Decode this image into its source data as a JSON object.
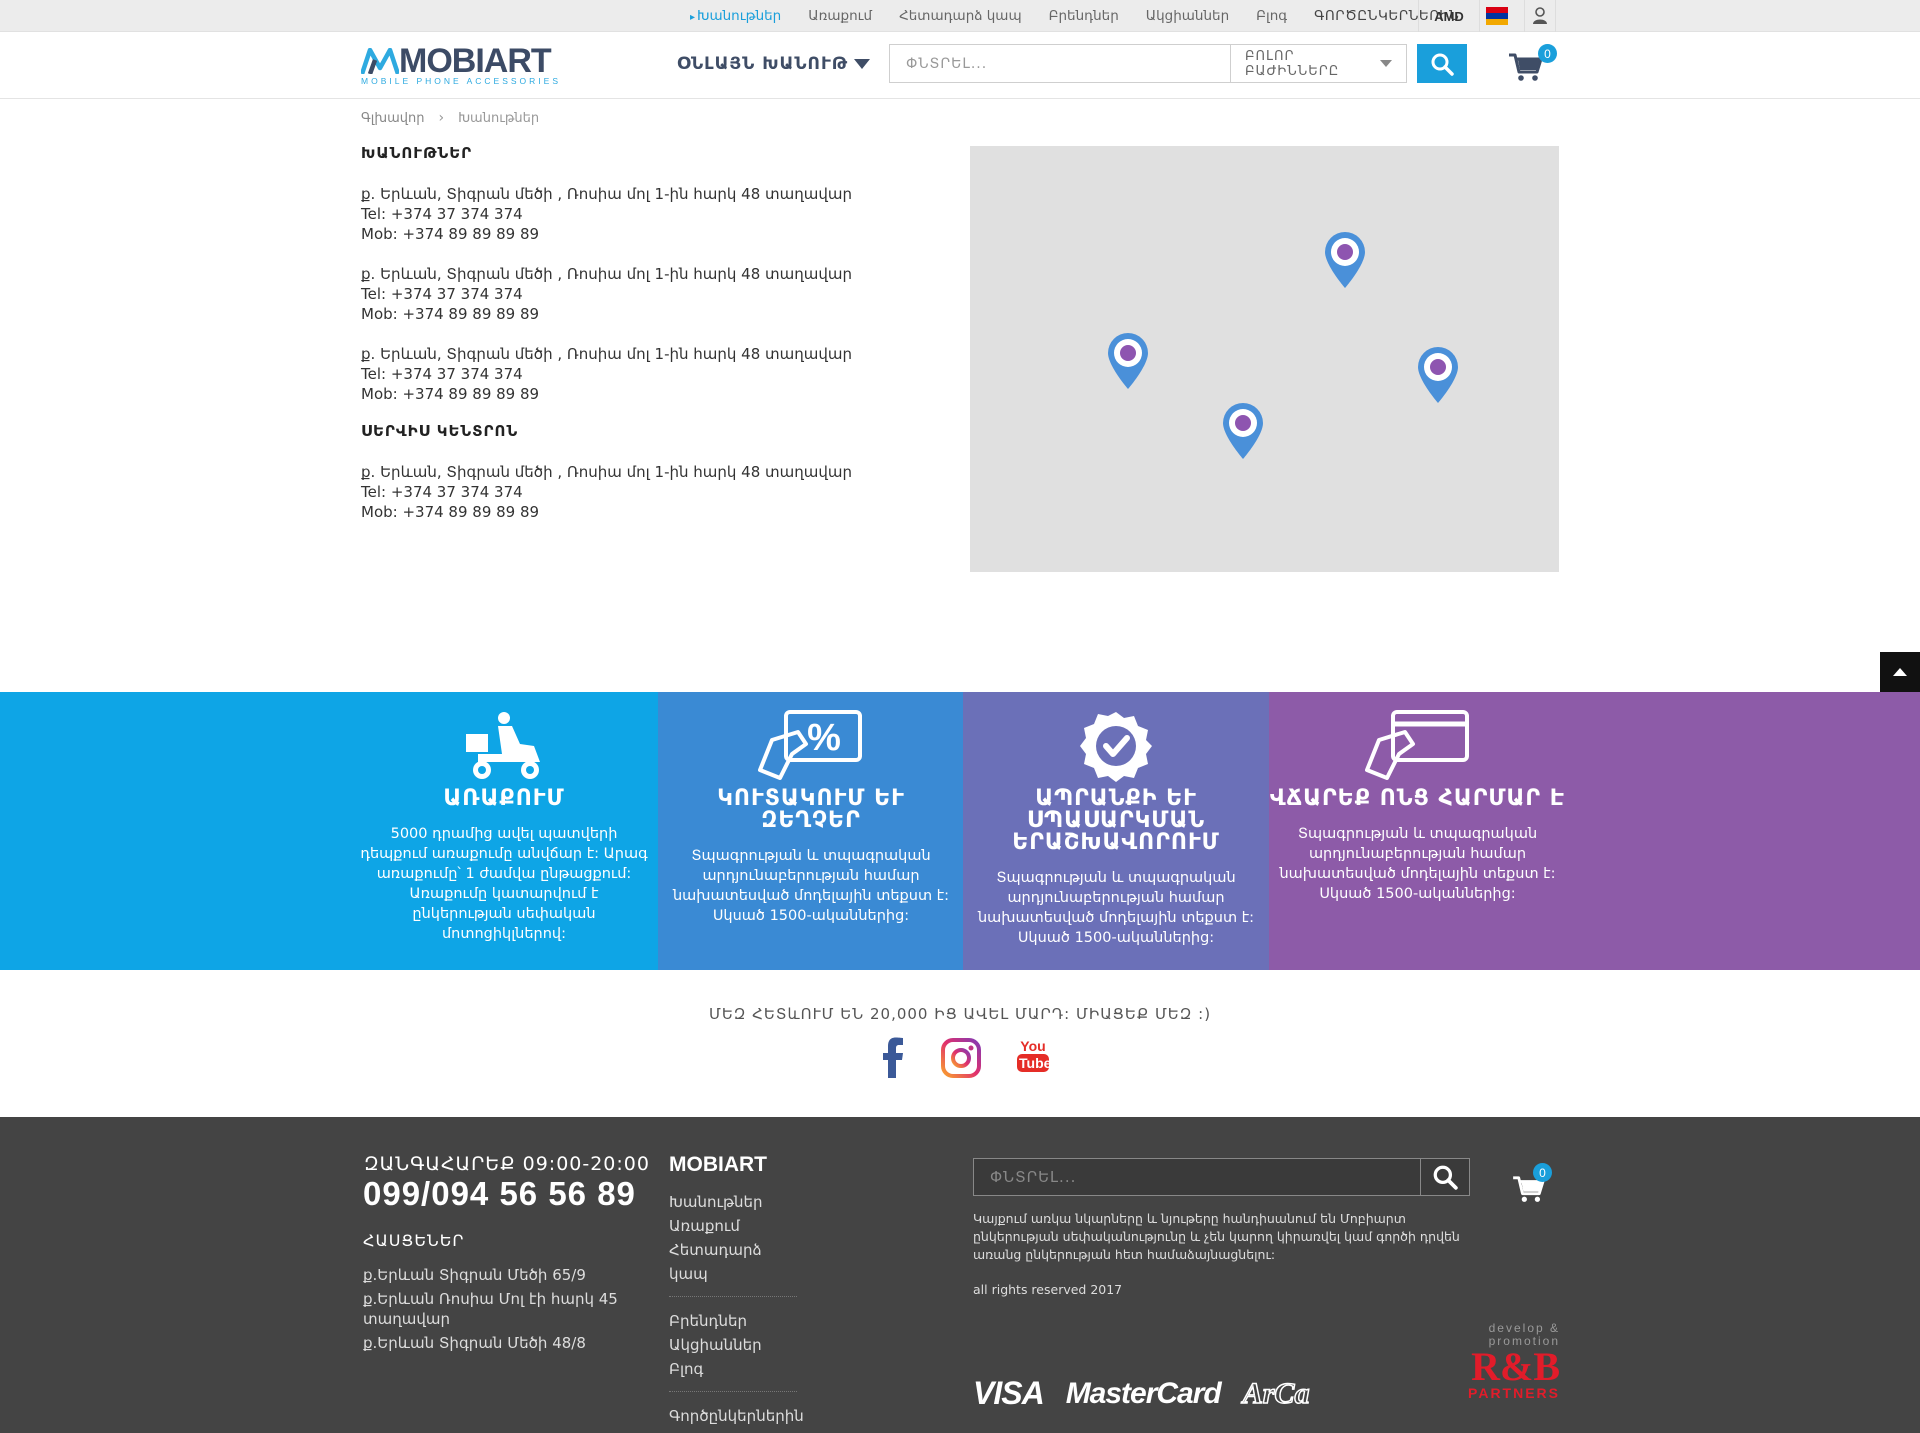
{
  "topbar": {
    "nav": [
      "Խանութներ",
      "Առաքում",
      "Հետադարձ կապ",
      "Բրենդներ",
      "Ակցիաններ",
      "Բլոգ",
      "ԳՈՐԾԸՆԿԵՐՆԵՐԻՆ"
    ],
    "currency": "AMD"
  },
  "header": {
    "logo_text": "MOBIART",
    "logo_sub": "MOBILE PHONE ACCESSORIES",
    "online_store": "ՕՆԼԱՅՆ ԽԱՆՈՒԹ",
    "search_placeholder": "ՓՆՏՐԵԼ...",
    "category": "ԲՈԼՈՐ ԲԱԺԻՆՆԵՐԸ",
    "cart_count": "0"
  },
  "breadcrumb": {
    "home": "Գլխավոր",
    "current": "Խանութներ"
  },
  "stores": {
    "title": "ԽԱՆՈՒԹՆԵՐ",
    "items": [
      {
        "address": "ք. Երևան, Տիգրան մեծի , Ռոսիա մոլ 1-ին հարկ 48 տաղավար",
        "tel": "Tel: +374 37 374 374",
        "mob": "Mob: +374 89 89 89 89"
      },
      {
        "address": "ք. Երևան, Տիգրան մեծի , Ռոսիա մոլ 1-ին հարկ 48 տաղավար",
        "tel": "Tel: +374 37 374 374",
        "mob": "Mob: +374 89 89 89 89"
      },
      {
        "address": "ք. Երևան, Տիգրան մեծի , Ռոսիա մոլ 1-ին հարկ 48 տաղավար",
        "tel": "Tel: +374 37 374 374",
        "mob": "Mob: +374 89 89 89 89"
      }
    ]
  },
  "service": {
    "title": "ՍԵՐՎԻՍ ԿԵՆՏՐՈՆ",
    "items": [
      {
        "address": "ք. Երևան, Տիգրան մեծի , Ռոսիա մոլ 1-ին հարկ 48 տաղավար",
        "tel": "Tel: +374 37 374 374",
        "mob": "Mob: +374 89 89 89 89"
      }
    ]
  },
  "features": [
    {
      "title": "ԱՌԱՔՈՒՄ",
      "text": "5000 դրամից ավել պատվերի դեպքում առաքումը անվճար է: Արագ առաքումը՝ 1 ժամվա ընթացքում: Առաքումը կատարվում է ընկերության սեփական մոտոցիկլներով:",
      "color": "#0ea5e6",
      "icon": "delivery-scooter-icon"
    },
    {
      "title": "ԿՈՒՏԱԿՈՒՄ ԵՒ ԶԵՂՉԵՐ",
      "text": "Տպագրության և տպագրական արդյունաբերության համար նախատեսված մոդելային տեքստ է: Սկսած 1500-ականներից:",
      "color": "#3a8ad4",
      "icon": "discount-card-icon"
    },
    {
      "title": "ԱՊՐԱՆՔԻ ԵՒ ՍՊԱՍԱՐԿՄԱՆ ԵՐԱՇԽԱՎՈՐՈՒՄ",
      "text": "Տպագրության և տպագրական արդյունաբերության համար նախատեսված մոդելային տեքստ է: Սկսած 1500-ականներից:",
      "color": "#6b70b8",
      "icon": "guarantee-badge-icon"
    },
    {
      "title": "ՎՃԱՐԵՔ ՈՆՑ ՀԱՐՄԱՐ Է",
      "text": "Տպագրության և տպագրական արդյունաբերության համար նախատեսված մոդելային տեքստ է: Սկսած 1500-ականներից:",
      "color": "#8d5ba8",
      "icon": "payment-card-icon"
    }
  ],
  "social": {
    "text": "ՄԵԶ ՀԵՏևՈՒՄ ԵՆ 20,000 ԻՑ ԱՎԵԼ ՄԱՐԴ: ՄԻԱՑԵՔ ՄԵԶ :)",
    "youtube_you": "You",
    "youtube_tube": "Tube"
  },
  "footer": {
    "call": "ԶԱՆԳԱՀԱՐԵՔ 09:00-20:00",
    "phone": "099/094 56 56 89",
    "addresses_title": "ՀԱՍՑԵՆԵՐ",
    "addresses": [
      "ք.Երևան Տիգրան Մեծի 65/9",
      "ք.Երևան Ռոսիա Մոլ էի հարկ 45 տաղավար",
      "ք.Երևան Տիգրան Մեծի 48/8"
    ],
    "brand": "MOBIART",
    "links_1": [
      "Խանութներ",
      "Առաքում",
      "Հետադարձ կապ"
    ],
    "links_2": [
      "Բրենդներ",
      "Ակցիաններ",
      "Բլոգ"
    ],
    "links_3": [
      "Գործընկերներին"
    ],
    "search_placeholder": "ՓՆՏՐԵԼ...",
    "cart_count": "0",
    "disclaimer": "Կայքում առկա նկարները և նյութերը հանդիսանում են Մոբիարտ ընկերության սեփականությունը և չեն կարող կիրառվել կամ գործի դրվեն առանց ընկերության հետ համաձայնացնելու:",
    "rights": "all rights reserved 2017",
    "cards": [
      "VISA",
      "MasterCard",
      "ArCa"
    ],
    "dev_line1": "develop &",
    "dev_line2": "promotion",
    "dev_logo": "R&B",
    "dev_partners": "PARTNERS"
  },
  "colors": {
    "accent": "#1a9fdb",
    "map_pin": "#4a90d9",
    "map_pin_center": "#8e55b0",
    "footer_bg": "#444444",
    "rb_red": "#e21c2a"
  }
}
